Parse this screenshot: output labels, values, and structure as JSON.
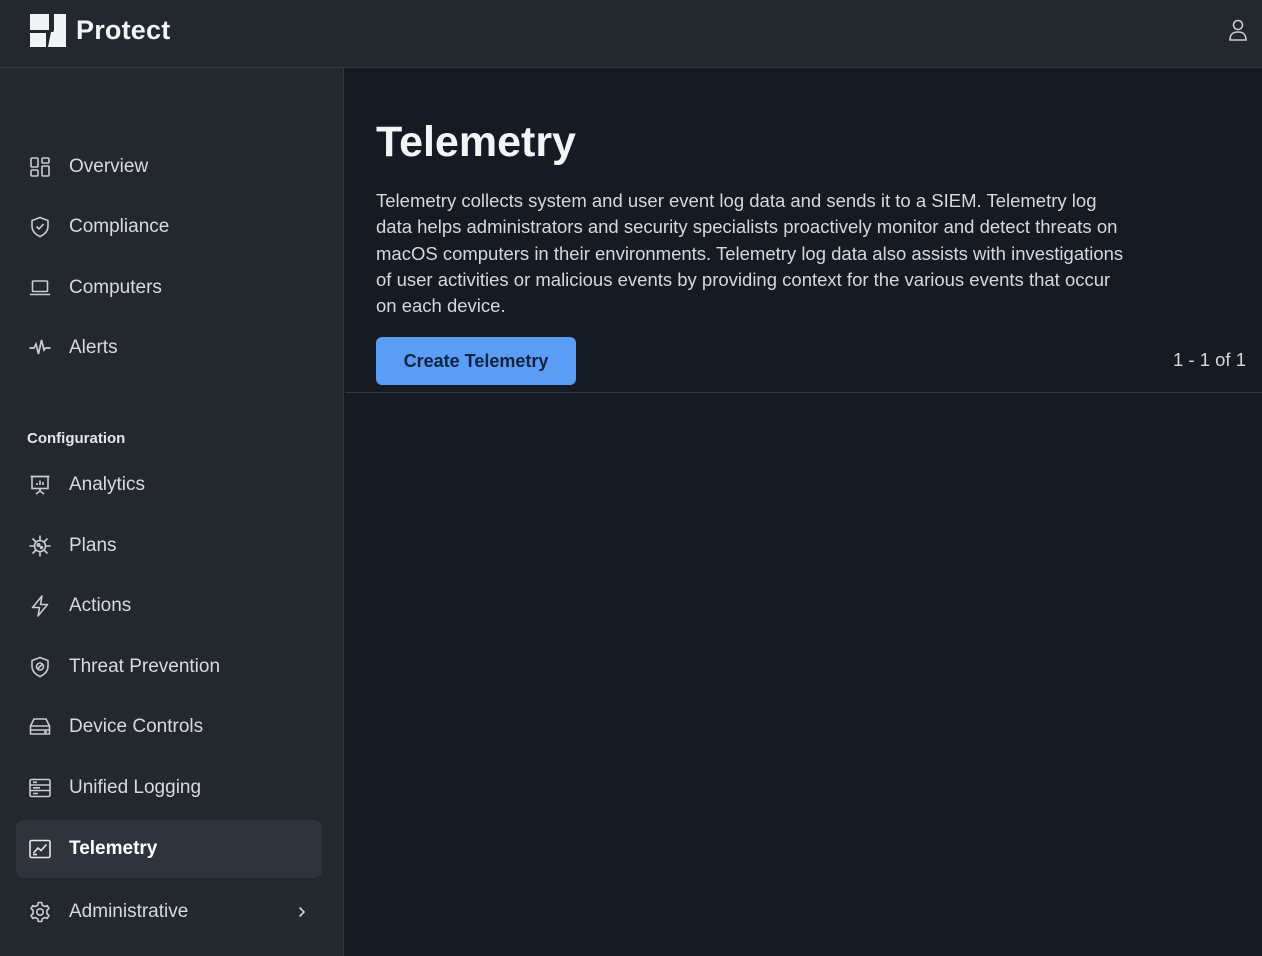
{
  "header": {
    "app_title": "Protect",
    "logo_icon": "protect-logo",
    "user_icon": "user-icon"
  },
  "sidebar": {
    "items": [
      {
        "label": "Overview",
        "icon": "grid-icon"
      },
      {
        "label": "Compliance",
        "icon": "shield-check-icon"
      },
      {
        "label": "Computers",
        "icon": "laptop-icon"
      },
      {
        "label": "Alerts",
        "icon": "pulse-icon"
      }
    ],
    "section_label": "Configuration",
    "config_items": [
      {
        "label": "Analytics",
        "icon": "presentation-chart-icon"
      },
      {
        "label": "Plans",
        "icon": "virus-icon"
      },
      {
        "label": "Actions",
        "icon": "lightning-icon"
      },
      {
        "label": "Threat Prevention",
        "icon": "shield-target-icon"
      },
      {
        "label": "Device Controls",
        "icon": "drive-icon"
      },
      {
        "label": "Unified Logging",
        "icon": "log-list-icon"
      },
      {
        "label": "Telemetry",
        "icon": "telemetry-chart-icon",
        "active": true
      },
      {
        "label": "Administrative",
        "icon": "gear-icon"
      }
    ]
  },
  "main": {
    "title": "Telemetry",
    "description": "Telemetry collects system and user event log data and sends it to a SIEM. Telemetry log data helps administrators and security specialists proactively monitor and detect threats on macOS computers in their environments. Telemetry log data also assists with investigations of user activities or malicious events by providing context for the various events that occur on each device.",
    "create_button": "Create Telemetry",
    "pagination": "1 - 1 of 1"
  },
  "colors": {
    "accent": "#5b9df5",
    "sidebar_bg": "#23272e",
    "main_bg": "#161a22",
    "active_item_bg": "#2f343c"
  }
}
